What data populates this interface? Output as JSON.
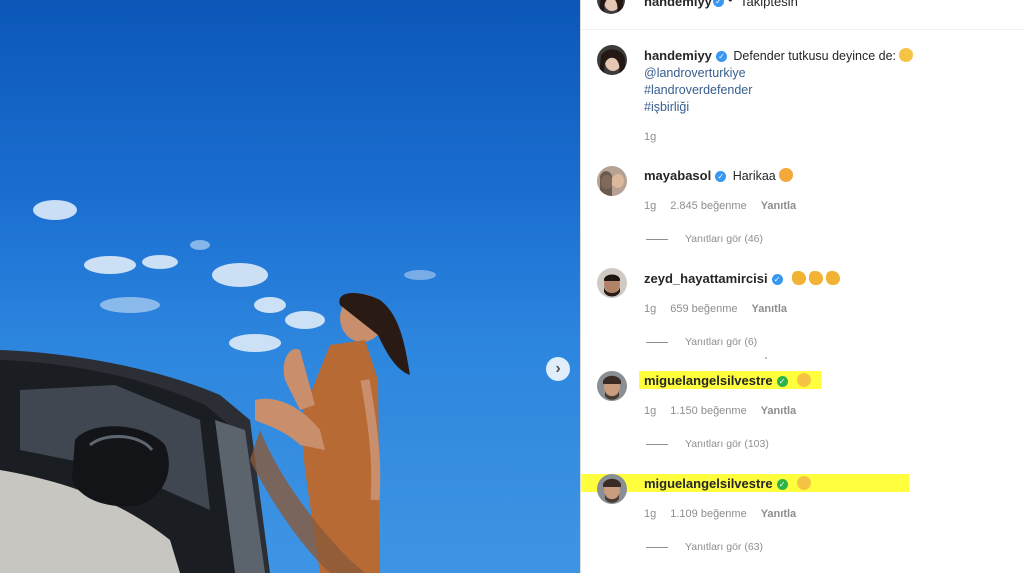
{
  "post": {
    "author": "handemiyy",
    "follow_text": "Takiptesin",
    "caption_text": "Defender tutkusu deyince de:",
    "mention": "@landroverturkiye",
    "hashtag1": "#landroverdefender",
    "hashtag2": "#işbirliği",
    "time": "1g"
  },
  "comments": [
    {
      "user": "mayabasol",
      "text": "Harikaa",
      "time": "1g",
      "likes": "2.845 beğenme",
      "reply": "Yanıtla",
      "view_replies": "Yanıtları gör (46)"
    },
    {
      "user": "zeyd_hayattamircisi",
      "text": "",
      "time": "1g",
      "likes": "659 beğenme",
      "reply": "Yanıtla",
      "view_replies": "Yanıtları gör (6)"
    },
    {
      "user": "miguelangelsilvestre",
      "text": "",
      "time": "1g",
      "likes": "1.150 beğenme",
      "reply": "Yanıtla",
      "view_replies": "Yanıtları gör (103)"
    },
    {
      "user": "miguelangelsilvestre",
      "text": "",
      "time": "1g",
      "likes": "1.109 beğenme",
      "reply": "Yanıtla",
      "view_replies": "Yanıtları gör (63)"
    }
  ],
  "icons": {
    "verified": "check-badge-icon",
    "next": "chevron-right-icon"
  },
  "colors": {
    "verified_blue": "#3897f0",
    "verified_green": "#2db34a",
    "highlight": "#ffff3d",
    "link": "#385e8f"
  }
}
